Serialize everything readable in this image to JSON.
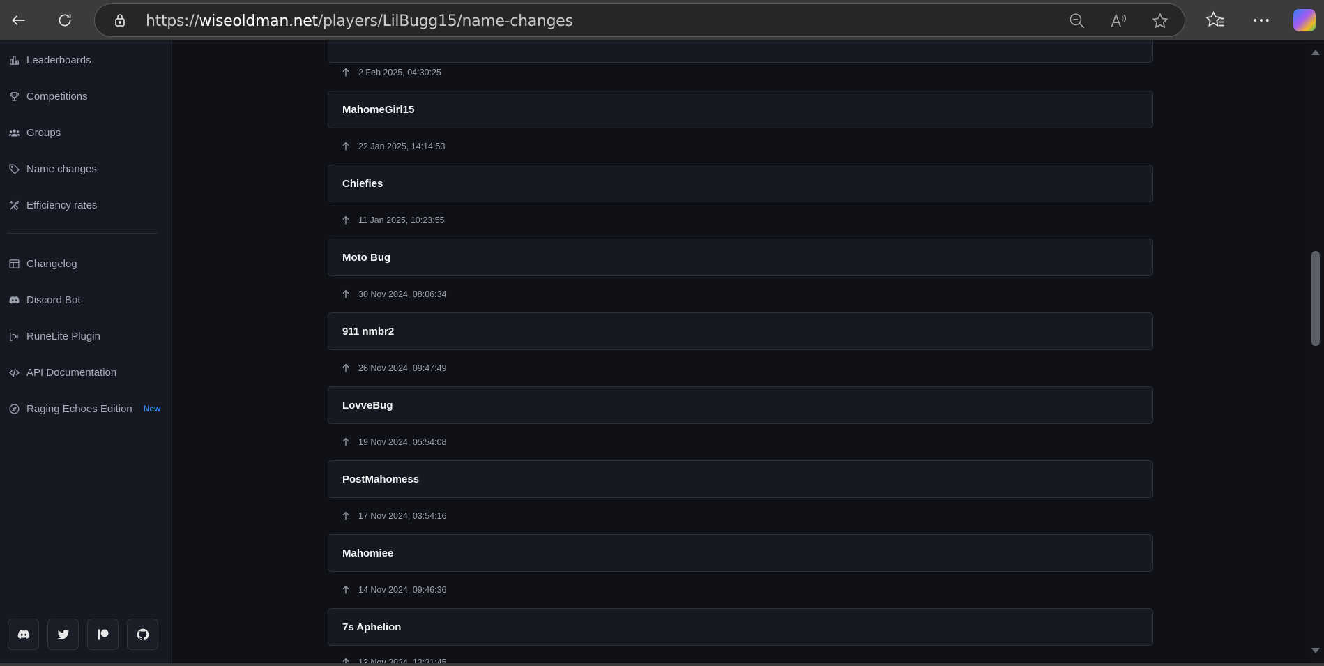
{
  "browser": {
    "url_prefix": "https://",
    "url_host": "wiseoldman.net",
    "url_path": "/players/LilBugg15/name-changes"
  },
  "sidebar": {
    "items": [
      {
        "label": "Leaderboards",
        "icon": "bar-chart-icon"
      },
      {
        "label": "Competitions",
        "icon": "trophy-icon"
      },
      {
        "label": "Groups",
        "icon": "users-icon"
      },
      {
        "label": "Name changes",
        "icon": "tag-icon"
      },
      {
        "label": "Efficiency rates",
        "icon": "tools-icon"
      }
    ],
    "secondary_items": [
      {
        "label": "Changelog",
        "icon": "layout-icon"
      },
      {
        "label": "Discord Bot",
        "icon": "discord-icon"
      },
      {
        "label": "RuneLite Plugin",
        "icon": "plugin-icon"
      },
      {
        "label": "API Documentation",
        "icon": "code-icon"
      },
      {
        "label": "Raging Echoes Edition",
        "icon": "compass-icon",
        "badge": "New"
      }
    ],
    "social": [
      "discord-icon",
      "twitter-icon",
      "patreon-icon",
      "github-icon"
    ]
  },
  "name_changes": {
    "dates": [
      "2 Feb 2025, 04:30:25",
      "22 Jan 2025, 14:14:53",
      "11 Jan 2025, 10:23:55",
      "30 Nov 2024, 08:06:34",
      "26 Nov 2024, 09:47:49",
      "19 Nov 2024, 05:54:08",
      "17 Nov 2024, 03:54:16",
      "14 Nov 2024, 09:46:36",
      "13 Nov 2024, 12:21:45"
    ],
    "names": [
      "MahomeGirl15",
      "Chiefies",
      "Moto Bug",
      "911 nmbr2",
      "LovveBug",
      "PostMahomess",
      "Mahomiee",
      "7s Aphelion"
    ]
  },
  "colors": {
    "accent": "#3b82f6",
    "background": "#0f1117",
    "card": "#171922"
  }
}
